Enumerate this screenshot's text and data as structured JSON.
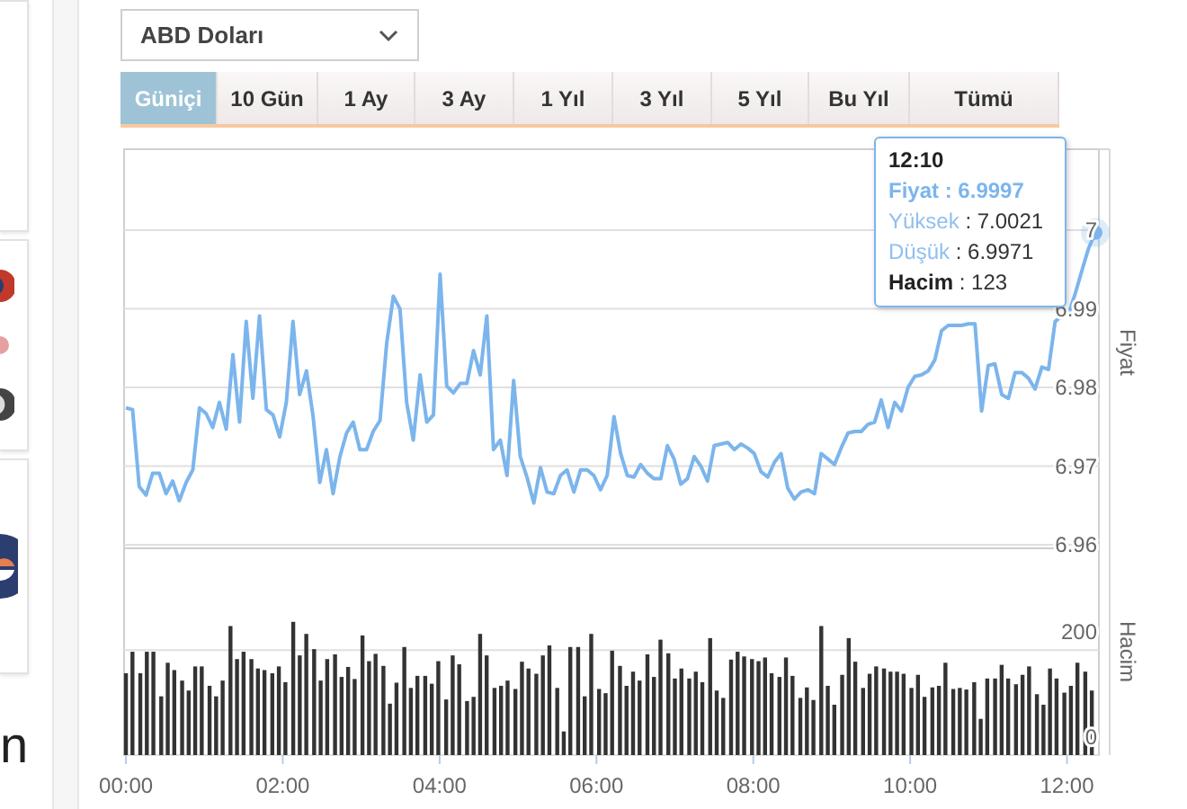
{
  "left_edge": {
    "text": "n"
  },
  "currency_select": {
    "value": "ABD Doları"
  },
  "periods": [
    {
      "label": "Güniçi",
      "selected": true
    },
    {
      "label": "10 Gün",
      "selected": false
    },
    {
      "label": "1 Ay",
      "selected": false
    },
    {
      "label": "3 Ay",
      "selected": false
    },
    {
      "label": "1 Yıl",
      "selected": false
    },
    {
      "label": "3 Yıl",
      "selected": false
    },
    {
      "label": "5 Yıl",
      "selected": false
    },
    {
      "label": "Bu Yıl",
      "selected": false
    },
    {
      "label": "Tümü",
      "selected": false
    }
  ],
  "price_chart": {
    "chart_data": {
      "type": "line",
      "ylabel": "Fiyat",
      "grid": true,
      "ylim": [
        6.96,
        7.0103
      ],
      "yticks": [
        {
          "value": 7,
          "label": "7"
        },
        {
          "value": 6.99,
          "label": "6.99"
        },
        {
          "value": 6.98,
          "label": "6.98"
        },
        {
          "value": 6.97,
          "label": "6.97"
        },
        {
          "value": 6.96,
          "label": "6.96"
        }
      ],
      "categories": [
        null,
        null,
        null,
        null,
        null,
        null,
        null,
        null,
        null,
        null,
        null,
        null,
        null,
        null,
        null,
        null,
        null,
        null,
        null,
        null,
        null,
        null,
        null,
        null,
        null,
        null,
        null,
        null,
        null,
        null,
        null,
        null,
        null,
        null,
        null,
        null,
        null,
        null,
        null,
        null,
        null,
        null,
        null,
        null,
        null,
        null,
        null,
        null,
        null,
        null,
        null,
        null,
        null,
        null,
        null,
        null,
        null,
        null,
        null,
        null,
        null,
        null,
        null,
        null,
        null,
        null,
        null,
        null,
        null,
        null,
        null,
        null,
        null,
        null,
        null,
        null,
        null,
        null,
        null,
        null,
        null,
        null,
        null,
        null,
        null,
        null,
        null,
        null,
        null,
        null,
        null,
        null,
        null,
        null,
        null,
        null,
        null,
        null,
        null,
        null,
        null,
        null,
        null,
        null,
        null,
        null,
        null,
        null,
        null,
        null,
        null,
        null,
        null,
        null,
        null,
        null,
        null,
        null,
        null,
        null,
        null,
        null,
        null,
        null,
        null,
        null,
        null,
        null,
        null,
        null,
        null,
        null,
        null,
        null,
        null,
        null,
        null,
        null,
        null,
        null,
        null,
        null,
        null,
        null,
        null,
        null
      ],
      "series": [
        {
          "color": "#7cb5ec",
          "values": [
            6.9774,
            6.9772,
            6.9674,
            6.9663,
            6.9691,
            6.9691,
            6.9665,
            6.9681,
            6.9656,
            6.9679,
            6.9695,
            6.9774,
            6.9767,
            6.9749,
            6.9781,
            6.9747,
            6.9842,
            6.9756,
            6.9884,
            6.9786,
            6.9891,
            6.9772,
            6.9765,
            6.9737,
            6.9781,
            6.9884,
            6.9791,
            6.9821,
            6.9763,
            6.9679,
            6.9721,
            6.9665,
            6.9712,
            6.9742,
            6.9756,
            6.9721,
            6.9721,
            6.9744,
            6.9758,
            6.9856,
            6.9916,
            6.99,
            6.9781,
            6.9733,
            6.9816,
            6.9756,
            6.9765,
            6.9944,
            6.9802,
            6.9793,
            6.9805,
            6.9805,
            6.9847,
            6.9816,
            6.9891,
            6.9721,
            6.9733,
            6.9688,
            6.9809,
            6.9712,
            6.9686,
            6.9653,
            6.9698,
            6.9667,
            6.9665,
            6.9688,
            6.9695,
            6.9667,
            6.9695,
            6.9695,
            6.9688,
            6.967,
            6.9688,
            6.9763,
            6.9716,
            6.9688,
            6.9686,
            6.9702,
            6.9691,
            6.9684,
            6.9684,
            6.9726,
            6.9709,
            6.9677,
            6.9684,
            6.9712,
            6.97,
            6.9681,
            6.9726,
            6.9728,
            6.973,
            6.9721,
            6.9728,
            6.9723,
            6.9716,
            6.9693,
            6.9686,
            6.9705,
            6.9716,
            6.9672,
            6.9658,
            6.9667,
            6.967,
            6.9665,
            6.9716,
            6.9709,
            6.9702,
            6.9723,
            6.9742,
            6.9744,
            6.9744,
            6.9753,
            6.9756,
            6.9784,
            6.9749,
            6.9781,
            6.977,
            6.98,
            6.9814,
            6.9816,
            6.9821,
            6.9835,
            6.9872,
            6.9879,
            6.9879,
            6.9879,
            6.9881,
            6.9881,
            6.977,
            6.9828,
            6.983,
            6.9791,
            6.9786,
            6.9819,
            6.9819,
            6.9812,
            6.9798,
            6.9826,
            6.9823,
            6.9884,
            6.9891,
            6.9893,
            6.9919,
            6.9949,
            6.9977,
            6.9997
          ]
        }
      ]
    }
  },
  "volume_chart": {
    "chart_data": {
      "type": "bar",
      "ylabel": "Hacim",
      "grid": true,
      "xlim": [
        -1.4,
        744.4
      ],
      "ylim": [
        0,
        401
      ],
      "yticks": [
        {
          "value": 200,
          "label": "200"
        },
        {
          "value": 0,
          "label": "0"
        }
      ],
      "xticks": [
        {
          "value": 0,
          "label": "00:00"
        },
        {
          "value": 120,
          "label": "02:00"
        },
        {
          "value": 240,
          "label": "04:00"
        },
        {
          "value": 360,
          "label": "06:00"
        },
        {
          "value": 480,
          "label": "08:00"
        },
        {
          "value": 600,
          "label": "10:00"
        },
        {
          "value": 720,
          "label": "12:00"
        }
      ],
      "x": [
        0,
        5,
        11,
        16,
        21,
        27,
        32,
        37,
        43,
        48,
        53,
        58,
        64,
        69,
        74,
        80,
        85,
        90,
        96,
        101,
        106,
        112,
        117,
        122,
        128,
        133,
        138,
        144,
        149,
        154,
        160,
        165,
        170,
        175,
        181,
        186,
        191,
        197,
        202,
        207,
        213,
        218,
        223,
        229,
        234,
        239,
        245,
        250,
        255,
        261,
        266,
        271,
        276,
        282,
        287,
        292,
        298,
        303,
        308,
        314,
        319,
        324,
        330,
        335,
        340,
        346,
        351,
        356,
        362,
        367,
        372,
        378,
        383,
        388,
        393,
        399,
        404,
        409,
        415,
        420,
        425,
        431,
        436,
        441,
        447,
        452,
        457,
        463,
        468,
        473,
        479,
        484,
        489,
        494,
        500,
        505,
        510,
        516,
        521,
        526,
        532,
        537,
        542,
        548,
        553,
        558,
        564,
        569,
        574,
        580,
        585,
        590,
        595,
        601,
        606,
        611,
        617,
        622,
        627,
        633,
        638,
        643,
        649,
        654,
        659,
        665,
        670,
        675,
        681,
        686,
        691,
        697,
        702,
        707,
        712,
        718,
        723,
        728,
        734,
        739
      ],
      "series": [
        {
          "color": "#333333",
          "values": [
            156,
            197,
            156,
            197,
            197,
            112,
            176,
            162,
            142,
            123,
            169,
            169,
            132,
            112,
            142,
            246,
            183,
            197,
            183,
            165,
            162,
            156,
            169,
            139,
            254,
            190,
            231,
            202,
            142,
            183,
            192,
            149,
            168,
            145,
            228,
            179,
            193,
            170,
            98,
            138,
            206,
            128,
            151,
            151,
            136,
            179,
            106,
            190,
            173,
            103,
            111,
            231,
            190,
            128,
            132,
            142,
            126,
            178,
            165,
            155,
            190,
            209,
            128,
            45,
            206,
            206,
            112,
            231,
            126,
            118,
            199,
            170,
            132,
            159,
            142,
            192,
            149,
            220,
            194,
            146,
            165,
            146,
            159,
            139,
            223,
            123,
            109,
            182,
            197,
            188,
            183,
            179,
            186,
            156,
            149,
            186,
            151,
            109,
            129,
            105,
            246,
            132,
            96,
            153,
            223,
            178,
            128,
            155,
            169,
            165,
            159,
            159,
            155,
            128,
            153,
            111,
            129,
            132,
            176,
            126,
            128,
            125,
            139,
            69,
            146,
            146,
            172,
            146,
            135,
            153,
            169,
            116,
            96,
            165,
            146,
            119,
            132,
            176,
            159,
            123
          ]
        }
      ]
    }
  },
  "tooltip": {
    "time": "12:10",
    "rows": [
      {
        "kind": "price",
        "label": "Fiyat",
        "value": " : 6.9997"
      },
      {
        "kind": "range",
        "label": "Yüksek",
        "value": " : 7.0021"
      },
      {
        "kind": "range",
        "label": "Düşük",
        "value": " : 6.9971"
      },
      {
        "kind": "volume",
        "label": "Hacim",
        "value": " : 123"
      }
    ]
  }
}
